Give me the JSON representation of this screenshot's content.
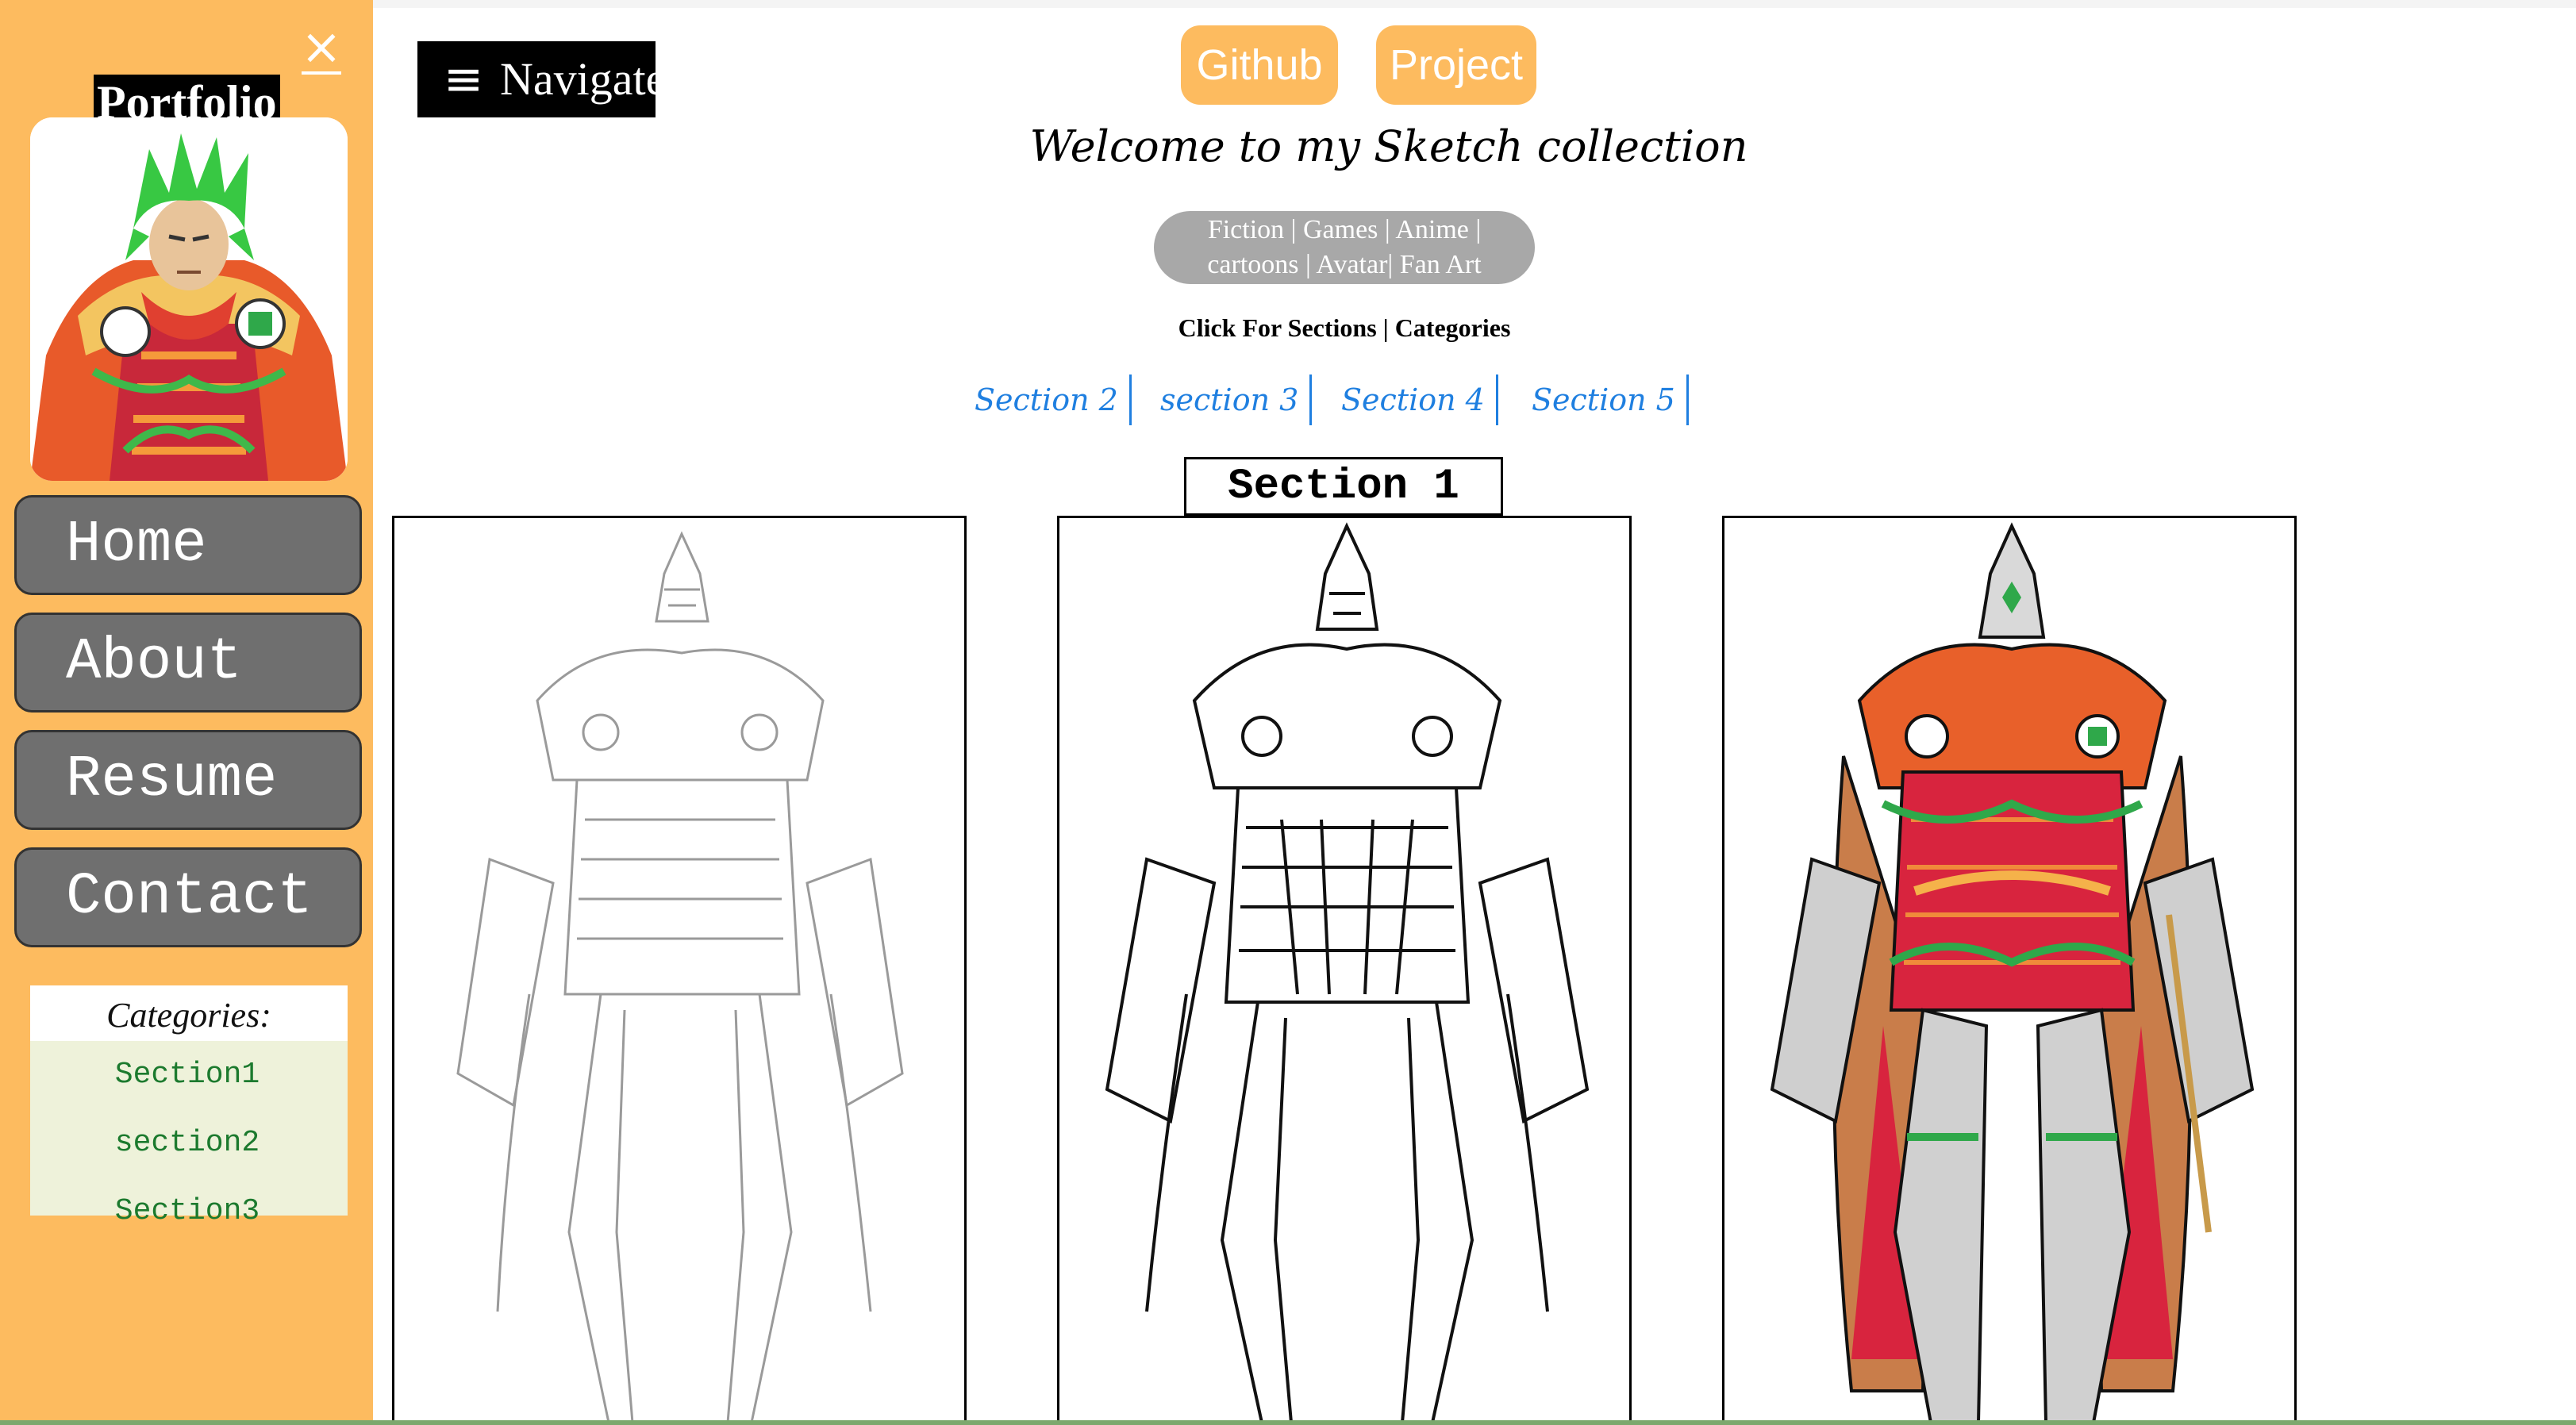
{
  "sidebar": {
    "close_label": "×",
    "brand_prefix": "Port",
    "brand_suffix": "folio",
    "nav": [
      "Home",
      "About",
      "Resume",
      "Contact"
    ],
    "categories_title": "Categories:",
    "categories": [
      "Section1",
      "section2",
      "Section3"
    ]
  },
  "header": {
    "navigate_icon": "≡",
    "navigate_label": "Navigate",
    "github_label": "Github",
    "project_label": "Project",
    "welcome": "Welcome to my Sketch collection",
    "tags_line1": "Fiction | Games | Anime |",
    "tags_line2": "cartoons | Avatar| Fan Art",
    "click_for": "Click For Sections | Categories",
    "section_links": [
      "Section 2",
      "section 3",
      "Section 4",
      "Section 5"
    ]
  },
  "main": {
    "section_title": "Section 1",
    "images": [
      "pencil-sketch-armor",
      "inked-lineart-armor",
      "colored-armor"
    ]
  },
  "colors": {
    "sidebar_bg": "#FDBB5F",
    "accent_orange": "#FDBB5F",
    "link_blue": "#1f7fe0",
    "category_green": "#1c7a2e",
    "nav_button_gray": "#6f6f6f",
    "pill_gray": "#a8a8a8"
  }
}
